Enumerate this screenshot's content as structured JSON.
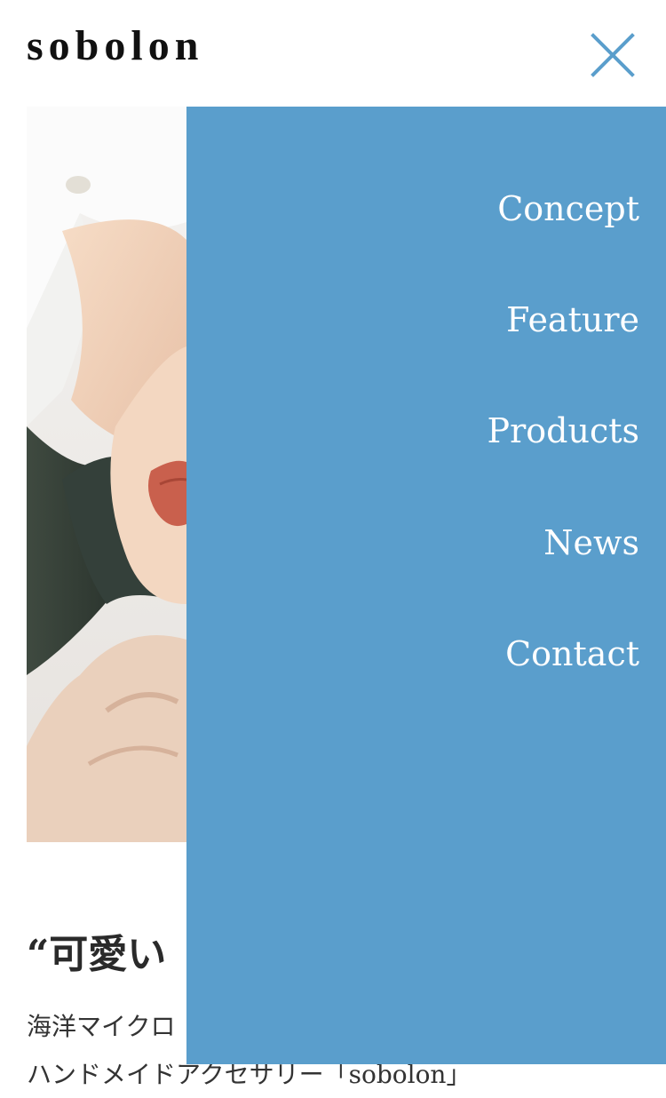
{
  "header": {
    "logo": "sobolon",
    "close_icon": "close-icon"
  },
  "hero": {
    "image": "portrait-photo"
  },
  "content": {
    "heading": "“可愛い",
    "line1": "海洋マイクロ",
    "line2": "ハンドメイドアクセサリー「sobolon」"
  },
  "menu": {
    "items": [
      {
        "label": "Concept"
      },
      {
        "label": "Feature"
      },
      {
        "label": "Products"
      },
      {
        "label": "News"
      },
      {
        "label": "Contact"
      }
    ]
  },
  "colors": {
    "menu_background": "#5a9ecc",
    "accent": "#5a9ecc",
    "menu_text": "#ffffff"
  }
}
